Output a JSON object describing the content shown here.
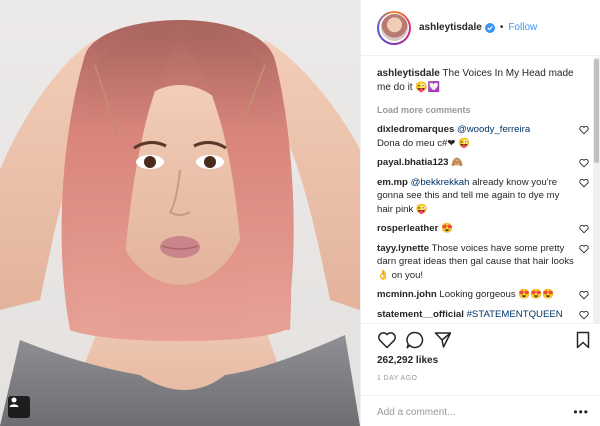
{
  "header": {
    "username": "ashleytisdale",
    "separator": "•",
    "follow_label": "Follow"
  },
  "caption": {
    "username": "ashleytisdale",
    "text": "The Voices In My Head made me do it 😜💟"
  },
  "load_more_label": "Load more comments",
  "comments": [
    {
      "user": "dixledromarques",
      "mention": "@woody_ferreira",
      "text": "Dona do meu c#❤ 😜"
    },
    {
      "user": "payal.bhatia123",
      "mention": "",
      "text": "🙈"
    },
    {
      "user": "em.mp",
      "mention": "@bekkrekkah",
      "text": "already know you're gonna see this and tell me again to dye my hair pink 😜"
    },
    {
      "user": "rosperleather",
      "mention": "",
      "text": "😍"
    },
    {
      "user": "tayy.lynette",
      "mention": "",
      "text": "Those voices have some pretty darn great ideas then gal cause that hair looks 👌 on you!"
    },
    {
      "user": "mcminn.john",
      "mention": "",
      "text": "Looking gorgeous 😍😍😍"
    },
    {
      "user": "statement__official",
      "mention": "",
      "text": "#STATEMENTQUEEN"
    },
    {
      "user": "",
      "mention": "",
      "text": ""
    }
  ],
  "likes_text": "262,292 likes",
  "time_ago": "1 DAY AGO",
  "add_comment_placeholder": "Add a comment...",
  "more_label": "•••",
  "icons": {
    "like": "heart-icon",
    "comment": "comment-bubble-icon",
    "share": "share-icon",
    "save": "bookmark-icon",
    "verified": "verified-badge-icon",
    "corner": "user-tag-icon"
  },
  "colors": {
    "link_blue": "#3897f0",
    "mention_blue": "#003569",
    "muted": "#999999",
    "text": "#262626"
  }
}
